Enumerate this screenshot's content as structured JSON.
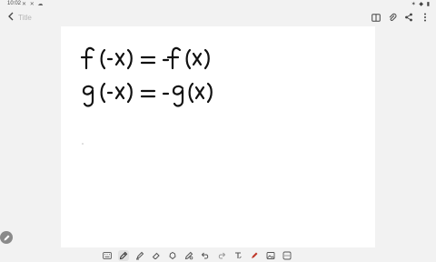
{
  "status": {
    "time": "10:02",
    "left_icons": "✕ ✕ ☁",
    "right_icons": "✶ ◆ ▮"
  },
  "header": {
    "title_placeholder": "Title"
  },
  "note": {
    "line1": "f(-x) = -f(x)",
    "line2": "g(-x) = -g(x)"
  },
  "colors": {
    "ink": "#111111",
    "canvas": "#ffffff",
    "chrome": "#f2f2f2",
    "highlight_red": "#c0392b"
  },
  "toolbar": {
    "tools": [
      "keyboard-icon",
      "pen-icon",
      "highlighter-icon",
      "eraser-icon",
      "lasso-icon",
      "insert-icon",
      "undo-icon",
      "redo-icon",
      "text-icon",
      "shape-icon",
      "image-icon",
      "more-icon"
    ]
  }
}
